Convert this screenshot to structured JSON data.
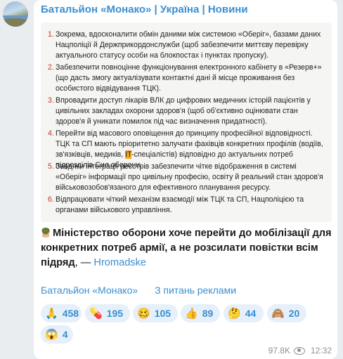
{
  "channel": {
    "title": "Батальйон «Монако» | Україна | Новини"
  },
  "document_items": [
    {
      "num": "1.",
      "text": "Зокрема, вдосконалити обмін даними між системою «Оберіг», базами даних Нацполіції й Держприкордонслужби (щоб забезпечити миттєву перевірку актуального статусу особи на блокпостах і пунктах пропуску)."
    },
    {
      "num": "2.",
      "text": "Забезпечити повноцінне функціонування електронного кабінету в «Резерв+» (що дасть змогу актуалізувати контактні дані й місце проживання без особистого відвідування ТЦК)."
    },
    {
      "num": "3.",
      "text": "Впровадити доступ лікарів ВЛК до цифрових медичних історій пацієнтів у цивільних закладах охорони здоров'я (щоб об'єктивно оцінювати стан здоров'я й уникати помилок під час визначення придатності)."
    },
    {
      "num": "4.",
      "text_before": "Перейти від масового оповіщення до принципу професійної відповідності. ТЦК та СП мають пріоритетно залучати фахівців конкретних профілів (водіїв, зв'язківців, медиків, ",
      "text_highlight": "IT",
      "text_after": "-спеціалістів) відповідно до актуальних потреб підрозділів Сил оборони."
    },
    {
      "num": "5.",
      "text": "Завдяки інтеграції реєстрів забезпечити чітке відображення в системі «Оберіг» інформації про цивільну професію, освіту й реальний стан здоров'я військовозобов'язаного для ефективного планування ресурсу."
    },
    {
      "num": "6.",
      "text": "Відпрацювати чіткий механізм взаємодії між ТЦК та СП, Нацполіцією та органами військового управління."
    }
  ],
  "headline": {
    "text": "Міністерство оборони хоче перейти до мобілізації для конкретних потреб армії, а не розсилати повістки всім підряд",
    "dash": ", —",
    "source": "Hromadske",
    "icon": "soldier-icon"
  },
  "links": {
    "channel": "Батальйон «Монако»",
    "ads": "З питань реклами"
  },
  "reactions": [
    {
      "emoji": "🙏",
      "icon": "pray-icon",
      "count": "458"
    },
    {
      "emoji": "💊",
      "icon": "pill-icon",
      "count": "195"
    },
    {
      "emoji": "🥴",
      "icon": "woozy-face-icon",
      "count": "105"
    },
    {
      "emoji": "👍",
      "icon": "thumbs-up-icon",
      "count": "89"
    },
    {
      "emoji": "🤔",
      "icon": "thinking-face-icon",
      "count": "44"
    },
    {
      "emoji": "🙈",
      "icon": "see-no-evil-monkey-icon",
      "count": "20"
    },
    {
      "emoji": "😱",
      "icon": "screaming-face-icon",
      "count": "4"
    }
  ],
  "meta": {
    "views": "97.8K",
    "time": "12:32"
  },
  "colors": {
    "accent": "#3a8fd0",
    "list_number": "#c0392b",
    "highlight": "#f5a623"
  }
}
